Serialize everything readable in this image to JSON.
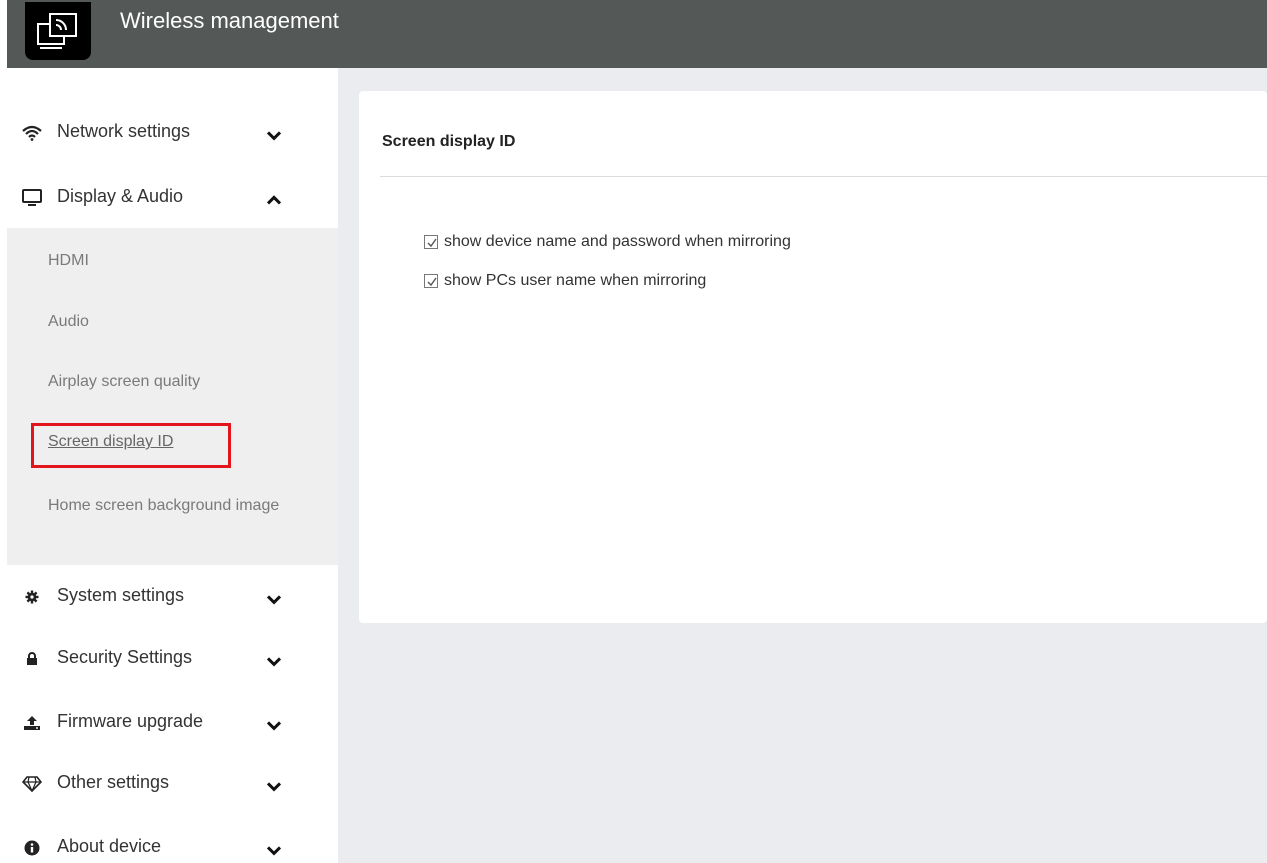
{
  "app": {
    "title": "Wireless management"
  },
  "sidebar": {
    "items": [
      {
        "label": "Network settings",
        "icon": "wifi-icon",
        "expanded": false
      },
      {
        "label": "Display & Audio",
        "icon": "monitor-icon",
        "expanded": true
      },
      {
        "label": "System settings",
        "icon": "gear-icon",
        "expanded": false
      },
      {
        "label": "Security Settings",
        "icon": "lock-icon",
        "expanded": false
      },
      {
        "label": "Firmware upgrade",
        "icon": "upload-icon",
        "expanded": false
      },
      {
        "label": "Other settings",
        "icon": "diamond-icon",
        "expanded": false
      },
      {
        "label": "About device",
        "icon": "info-icon",
        "expanded": false
      }
    ],
    "sub_items": [
      {
        "label": "HDMI"
      },
      {
        "label": "Audio"
      },
      {
        "label": "Airplay screen quality"
      },
      {
        "label": "Screen display ID",
        "active": true
      },
      {
        "label": "Home screen background image"
      }
    ]
  },
  "main": {
    "title": "Screen display ID",
    "options": [
      {
        "label": "show device name and password when mirroring",
        "checked": true
      },
      {
        "label": "show PCs user name when mirroring",
        "checked": true
      }
    ]
  },
  "colors": {
    "topbar": "#545958",
    "highlight": "#e4141c",
    "main_bg": "#eaecef"
  }
}
